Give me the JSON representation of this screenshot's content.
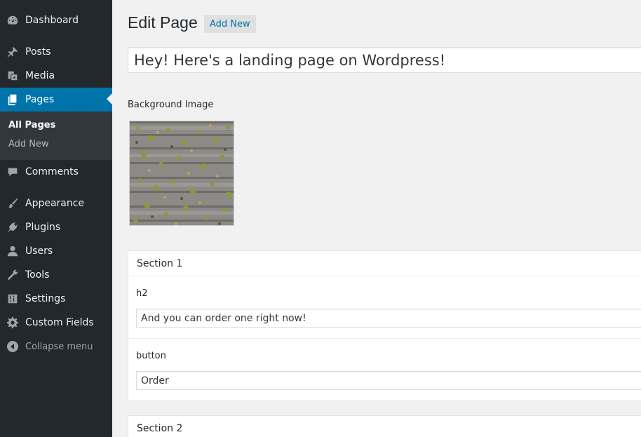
{
  "sidebar": {
    "items": [
      {
        "label": "Dashboard",
        "icon": "dashboard-icon"
      },
      {
        "label": "Posts",
        "icon": "pin-icon"
      },
      {
        "label": "Media",
        "icon": "media-icon"
      },
      {
        "label": "Pages",
        "icon": "pages-icon"
      },
      {
        "label": "Comments",
        "icon": "comment-icon"
      },
      {
        "label": "Appearance",
        "icon": "paintbrush-icon"
      },
      {
        "label": "Plugins",
        "icon": "plug-icon"
      },
      {
        "label": "Users",
        "icon": "user-icon"
      },
      {
        "label": "Tools",
        "icon": "wrench-icon"
      },
      {
        "label": "Settings",
        "icon": "settings-sliders-icon"
      },
      {
        "label": "Custom Fields",
        "icon": "gear-icon"
      }
    ],
    "submenu": {
      "all_pages": "All Pages",
      "add_new": "Add New"
    },
    "collapse": "Collapse menu",
    "active_color": "#0073aa"
  },
  "header": {
    "title": "Edit Page",
    "add_new": "Add New"
  },
  "post_title": "Hey! Here's a landing page on Wordpress!",
  "background_image": {
    "label": "Background Image"
  },
  "sections": [
    {
      "title": "Section 1",
      "fields": [
        {
          "label": "h2",
          "value": "And you can order one right now!"
        },
        {
          "label": "button",
          "value": "Order"
        }
      ]
    },
    {
      "title": "Section 2"
    }
  ]
}
